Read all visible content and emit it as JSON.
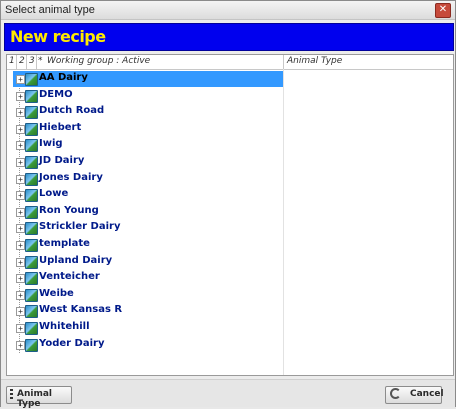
{
  "window": {
    "title": "Select animal type"
  },
  "banner": {
    "title": "New recipe"
  },
  "grid": {
    "header": {
      "col1": "1",
      "col2": "2",
      "col3": "3",
      "col_star": "*",
      "working_group": "Working group : Active",
      "animal_type": "Animal Type"
    },
    "rows": [
      {
        "label": "AA Dairy",
        "selected": true
      },
      {
        "label": "DEMO"
      },
      {
        "label": "Dutch Road"
      },
      {
        "label": "Hiebert"
      },
      {
        "label": "Iwig"
      },
      {
        "label": "JD Dairy"
      },
      {
        "label": "Jones Dairy"
      },
      {
        "label": "Lowe"
      },
      {
        "label": "Ron Young"
      },
      {
        "label": "Strickler Dairy"
      },
      {
        "label": "template"
      },
      {
        "label": "Upland Dairy"
      },
      {
        "label": "Venteicher"
      },
      {
        "label": "Weibe"
      },
      {
        "label": "West Kansas R"
      },
      {
        "label": "Whitehill"
      },
      {
        "label": "Yoder Dairy"
      }
    ],
    "expander_glyph": "+"
  },
  "footer": {
    "animal_type_button": "Animal Type",
    "cancel_button": "Cancel"
  },
  "colors": {
    "banner_bg": "#0000ee",
    "banner_text": "#ffea00",
    "selection": "#3399ff",
    "row_text": "#001a8a"
  },
  "icons": {
    "close": "close-icon",
    "row": "farm-icon",
    "expander": "expand-icon",
    "cancel": "cancel-icon",
    "animal": "list-icon"
  }
}
